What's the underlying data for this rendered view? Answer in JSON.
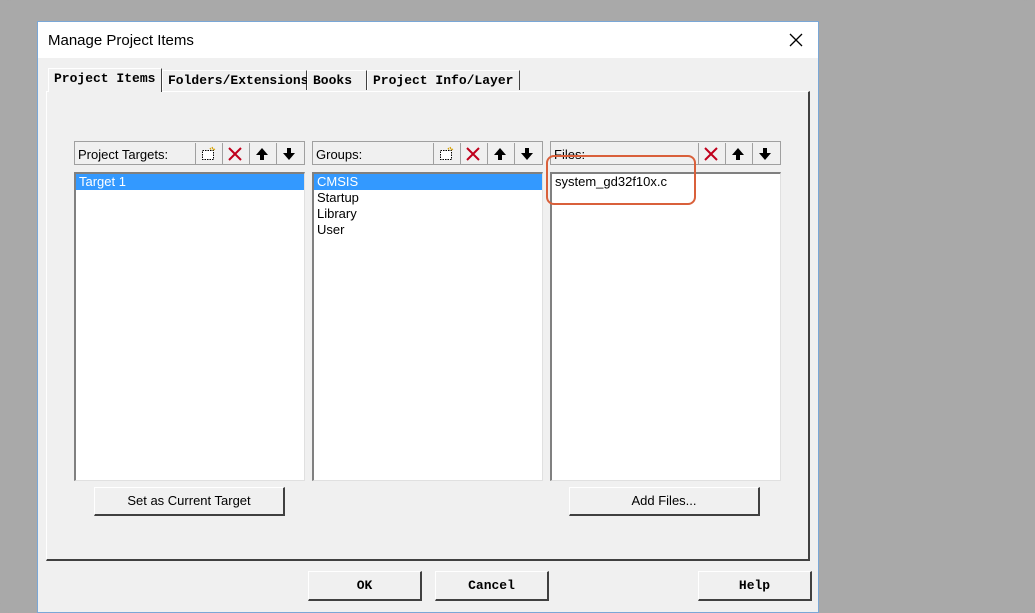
{
  "window": {
    "title": "Manage Project Items"
  },
  "tabs": [
    {
      "label": "Project Items",
      "active": true
    },
    {
      "label": "Folders/Extensions",
      "active": false
    },
    {
      "label": "Books",
      "active": false
    },
    {
      "label": "Project Info/Layer",
      "active": false
    }
  ],
  "targets": {
    "label": "Project Targets:",
    "items": [
      "Target 1"
    ],
    "selected_index": 0,
    "set_current_label": "Set as Current Target"
  },
  "groups": {
    "label": "Groups:",
    "items": [
      "CMSIS",
      "Startup",
      "Library",
      "User"
    ],
    "selected_index": 0
  },
  "files": {
    "label": "Files:",
    "items": [
      "system_gd32f10x.c"
    ],
    "add_files_label": "Add Files..."
  },
  "footer": {
    "ok_label": "OK",
    "cancel_label": "Cancel",
    "help_label": "Help"
  },
  "icons": {
    "new": "new-item-icon",
    "delete": "delete-x-icon",
    "move_up": "move-up-arrow-icon",
    "move_down": "move-down-arrow-icon",
    "close": "close-icon"
  },
  "colors": {
    "selection": "#3399ff",
    "delete_x": "#c0001c",
    "annotation_box": "#d9603b"
  }
}
